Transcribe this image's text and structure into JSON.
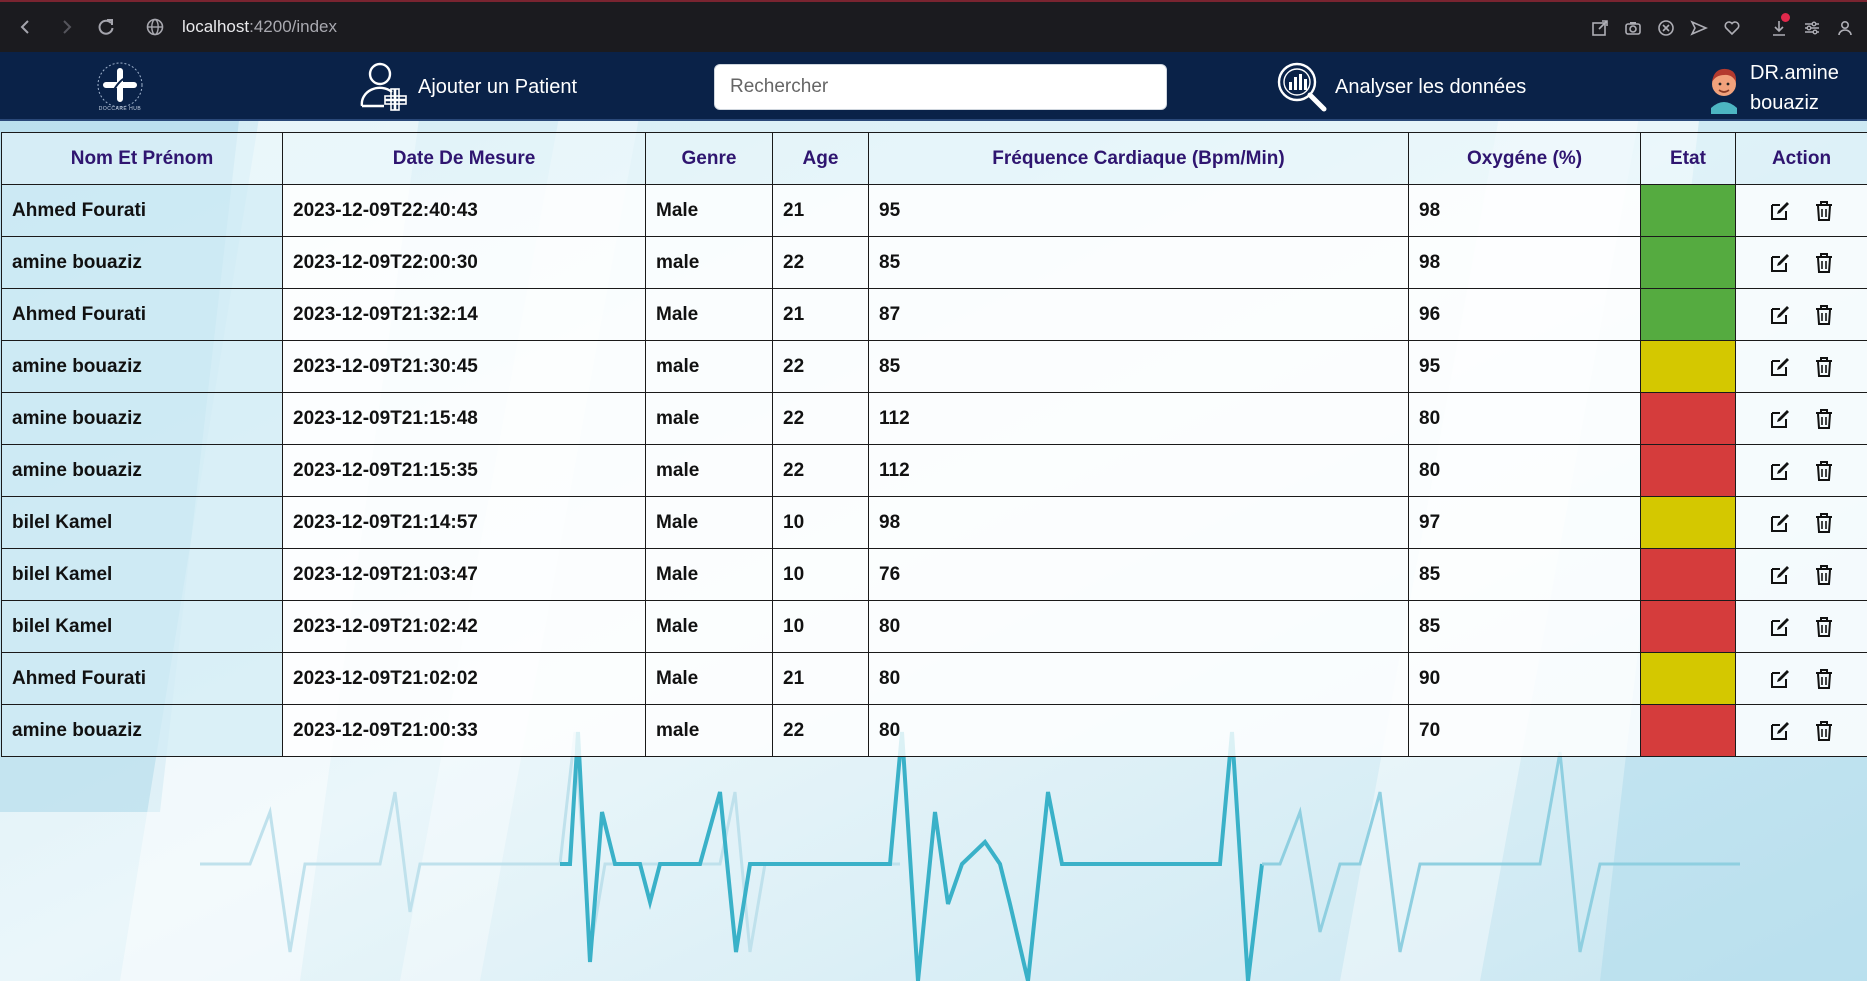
{
  "browser": {
    "url_host": "localhost",
    "url_path": ":4200/index",
    "icons": [
      "back-icon",
      "forward-icon",
      "reload-icon",
      "globe-icon",
      "share-icon",
      "camera-icon",
      "close-circle-icon",
      "send-icon",
      "heart-icon",
      "download-icon",
      "settings-sliders-icon",
      "profile-icon"
    ]
  },
  "header": {
    "logo_text": "DOCCARE HUB",
    "add_patient_label": "Ajouter un Patient",
    "search_placeholder": "Rechercher",
    "analyze_label": "Analyser les données",
    "doctor_line1": "DR.amine",
    "doctor_line2": "bouaziz"
  },
  "colors": {
    "header_bg": "#0a2248",
    "header_text": "#2f1570",
    "state_green": "#55ab40",
    "state_yellow": "#d4c800",
    "state_red": "#d53c3c"
  },
  "table": {
    "columns": [
      "Nom Et Prénom",
      "Date De Mesure",
      "Genre",
      "Age",
      "Fréquence Cardiaque (Bpm/Min)",
      "Oxygéne (%)",
      "Etat",
      "Action"
    ],
    "rows": [
      {
        "name": "Ahmed Fourati",
        "date": "2023-12-09T22:40:43",
        "genre": "Male",
        "age": "21",
        "freq": "95",
        "oxy": "98",
        "state": "green"
      },
      {
        "name": "amine bouaziz",
        "date": "2023-12-09T22:00:30",
        "genre": "male",
        "age": "22",
        "freq": "85",
        "oxy": "98",
        "state": "green"
      },
      {
        "name": "Ahmed Fourati",
        "date": "2023-12-09T21:32:14",
        "genre": "Male",
        "age": "21",
        "freq": "87",
        "oxy": "96",
        "state": "green"
      },
      {
        "name": "amine bouaziz",
        "date": "2023-12-09T21:30:45",
        "genre": "male",
        "age": "22",
        "freq": "85",
        "oxy": "95",
        "state": "yellow"
      },
      {
        "name": "amine bouaziz",
        "date": "2023-12-09T21:15:48",
        "genre": "male",
        "age": "22",
        "freq": "112",
        "oxy": "80",
        "state": "red"
      },
      {
        "name": "amine bouaziz",
        "date": "2023-12-09T21:15:35",
        "genre": "male",
        "age": "22",
        "freq": "112",
        "oxy": "80",
        "state": "red"
      },
      {
        "name": "bilel Kamel",
        "date": "2023-12-09T21:14:57",
        "genre": "Male",
        "age": "10",
        "freq": "98",
        "oxy": "97",
        "state": "yellow"
      },
      {
        "name": "bilel Kamel",
        "date": "2023-12-09T21:03:47",
        "genre": "Male",
        "age": "10",
        "freq": "76",
        "oxy": "85",
        "state": "red"
      },
      {
        "name": "bilel Kamel",
        "date": "2023-12-09T21:02:42",
        "genre": "Male",
        "age": "10",
        "freq": "80",
        "oxy": "85",
        "state": "red"
      },
      {
        "name": "Ahmed Fourati",
        "date": "2023-12-09T21:02:02",
        "genre": "Male",
        "age": "21",
        "freq": "80",
        "oxy": "90",
        "state": "yellow"
      },
      {
        "name": "amine bouaziz",
        "date": "2023-12-09T21:00:33",
        "genre": "male",
        "age": "22",
        "freq": "80",
        "oxy": "70",
        "state": "red"
      }
    ]
  }
}
